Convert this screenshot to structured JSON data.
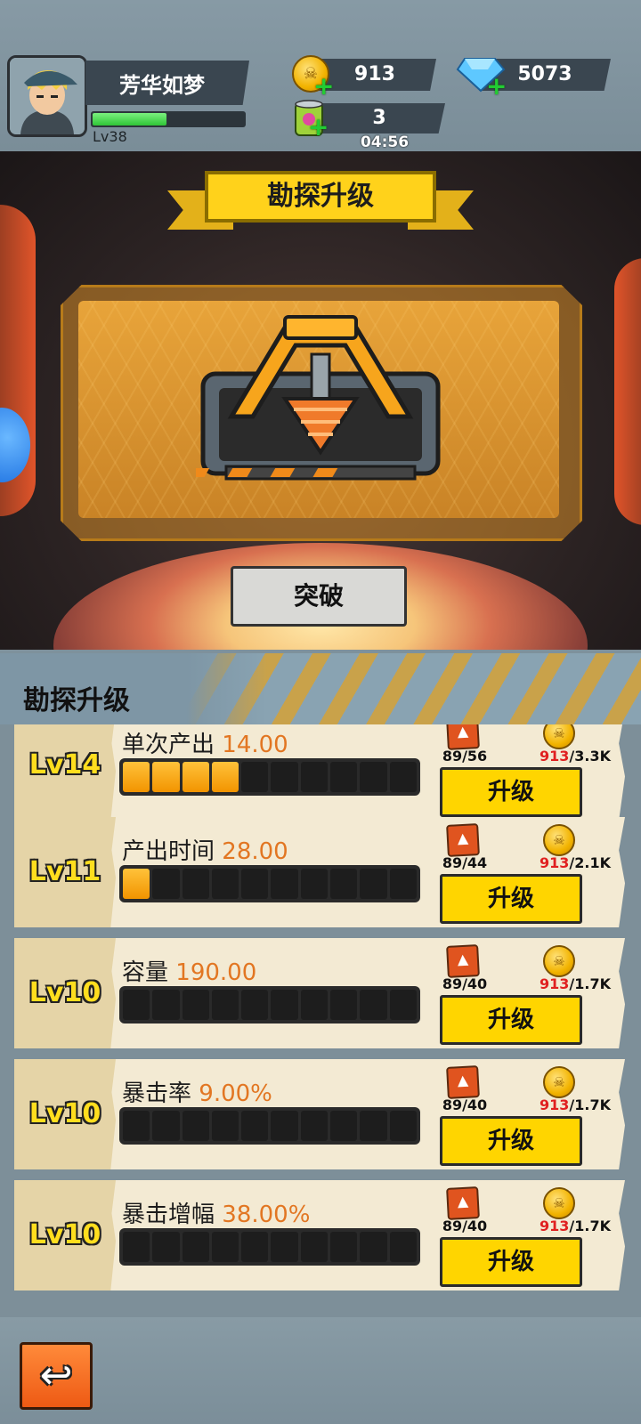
{
  "player": {
    "name": "芳华如梦",
    "level_label": "Lv38",
    "xp_progress": 0.5
  },
  "resources": {
    "coins": "913",
    "gems": "5073",
    "energy": "3",
    "energy_timer": "04:56",
    "coin_icon": "skull-coin-icon",
    "gem_icon": "diamond-icon",
    "energy_icon": "energy-can-icon"
  },
  "scene": {
    "banner_title": "勘探升级",
    "building_icon": "drill-icon",
    "break_button": "突破"
  },
  "section": {
    "title": "勘探升级"
  },
  "upgrades": [
    {
      "level": "Lv14",
      "name": "单次产出",
      "value": "14.00",
      "filled": 4,
      "ore_cost": "89/56",
      "coin_owned": "913",
      "coin_need": "/3.3K",
      "button": "升级"
    },
    {
      "level": "Lv11",
      "name": "产出时间",
      "value": "28.00",
      "filled": 1,
      "ore_cost": "89/44",
      "coin_owned": "913",
      "coin_need": "/2.1K",
      "button": "升级"
    },
    {
      "level": "Lv10",
      "name": "容量",
      "value": "190.00",
      "filled": 0,
      "ore_cost": "89/40",
      "coin_owned": "913",
      "coin_need": "/1.7K",
      "button": "升级"
    },
    {
      "level": "Lv10",
      "name": "暴击率",
      "value": "9.00%",
      "filled": 0,
      "ore_cost": "89/40",
      "coin_owned": "913",
      "coin_need": "/1.7K",
      "button": "升级"
    },
    {
      "level": "Lv10",
      "name": "暴击增幅",
      "value": "38.00%",
      "filled": 0,
      "ore_cost": "89/40",
      "coin_owned": "913",
      "coin_need": "/1.7K",
      "button": "升级"
    }
  ],
  "bottom": {
    "back_icon": "back-arrow-icon",
    "back_glyph": "↩"
  },
  "colors": {
    "accent": "#ffd500",
    "value_orange": "#e27622",
    "owned_red": "#e02020",
    "bar_fill": "#f29400"
  }
}
